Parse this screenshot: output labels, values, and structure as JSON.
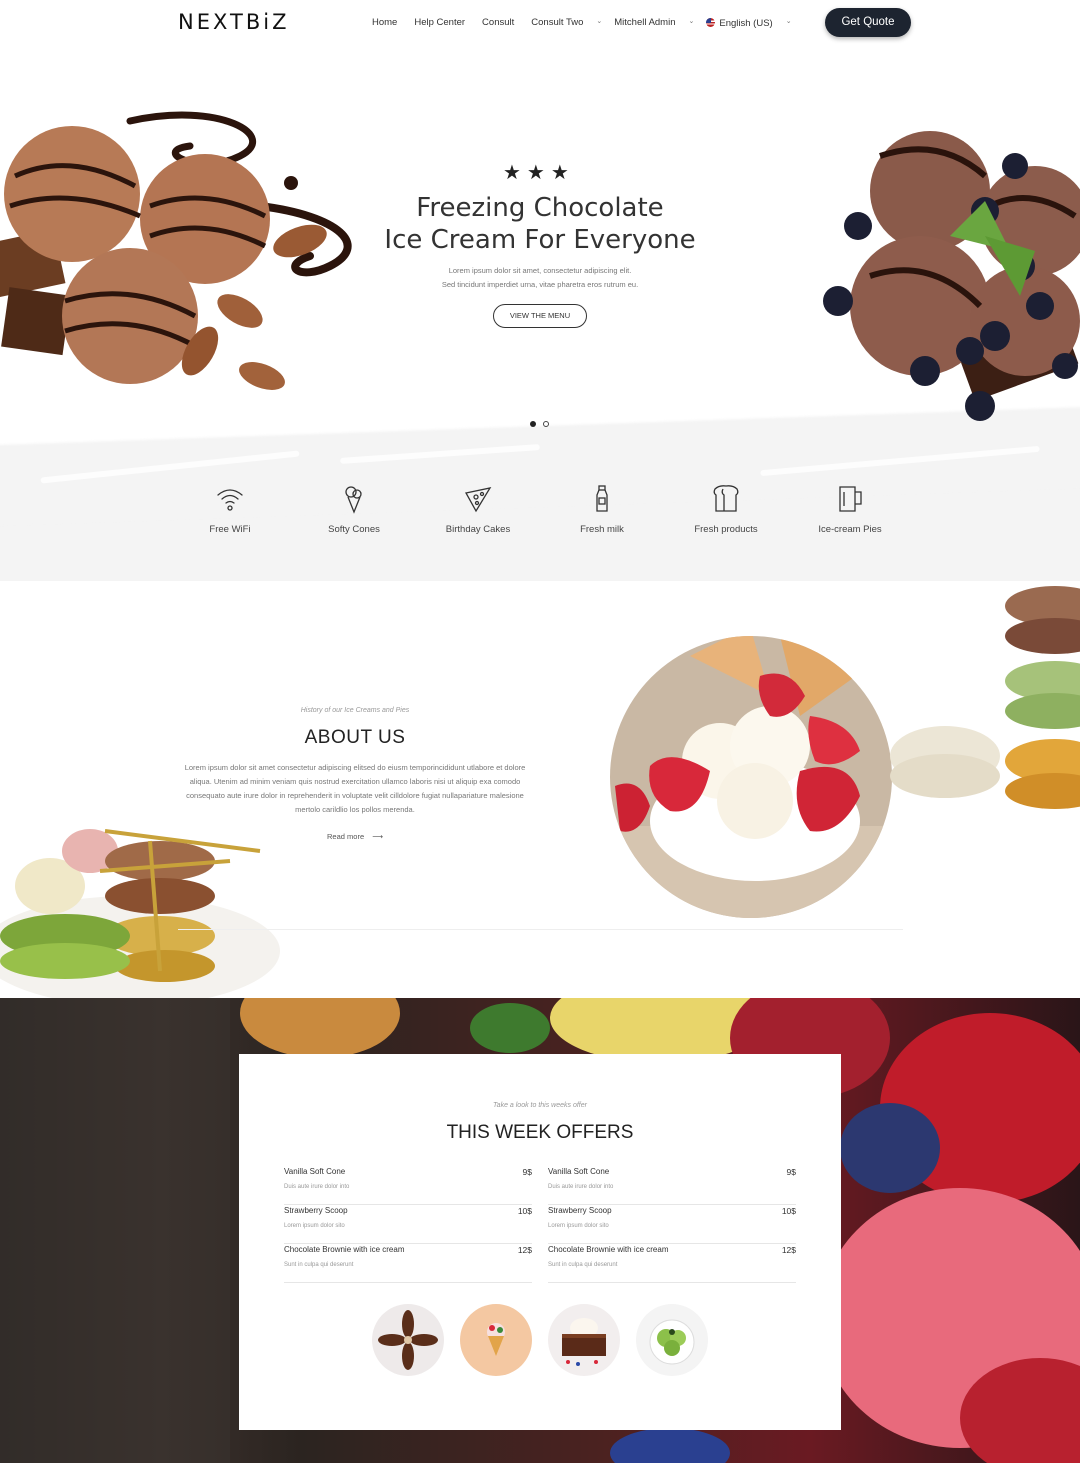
{
  "header": {
    "logo": "NEXTBiZ",
    "nav": [
      "Home",
      "Help Center",
      "Consult",
      "Consult Two"
    ],
    "user_menu": "Mitchell Admin",
    "language": "English (US)",
    "cta": "Get Quote"
  },
  "hero": {
    "stars": "★★★",
    "title_line1": "Freezing Chocolate",
    "title_line2": "Ice Cream For Everyone",
    "subtitle_line1": "Lorem ipsum dolor sit amet, consectetur adipiscing elit.",
    "subtitle_line2": "Sed tincidunt imperdiet urna, vitae pharetra eros rutrum eu.",
    "button": "VIEW THE MENU",
    "slides_total": 2,
    "active_slide": 1
  },
  "features": [
    {
      "label": "Free WiFi",
      "icon": "wifi-icon"
    },
    {
      "label": "Softy Cones",
      "icon": "ice-cream-cone-icon"
    },
    {
      "label": "Birthday Cakes",
      "icon": "pizza-slice-icon"
    },
    {
      "label": "Fresh milk",
      "icon": "milk-bottle-icon"
    },
    {
      "label": "Fresh products",
      "icon": "bread-icon"
    },
    {
      "label": "Ice-cream Pies",
      "icon": "mug-icon"
    }
  ],
  "about": {
    "kicker": "History of our Ice Creams and Pies",
    "title": "ABOUT US",
    "text": "Lorem ipsum dolor sit amet consectetur adipiscing elitsed do eiusm temporincididunt utlabore et dolore aliqua. Utenim ad minim veniam quis nostrud exercitation ullamco laboris nisi ut aliquip exa comodo consequato aute irure dolor in reprehenderit in voluptate velit cilldolore fugiat nullapariature malesione mertolo carildlio los pollos merenda.",
    "read_more": "Read more",
    "arrow": "⟶"
  },
  "offers": {
    "kicker": "Take a look to this weeks offer",
    "title": "THIS WEEK OFFERS",
    "left": [
      {
        "name": "Vanilla Soft Cone",
        "price": "9$",
        "desc": "Duis aute irure dolor into"
      },
      {
        "name": "Strawberry Scoop",
        "price": "10$",
        "desc": "Lorem ipsum dolor sito"
      },
      {
        "name": "Chocolate Brownie with ice cream",
        "price": "12$",
        "desc": "Sunt in culpa qui deserunt"
      }
    ],
    "right": [
      {
        "name": "Vanilla Soft Cone",
        "price": "9$",
        "desc": "Duis aute irure dolor into"
      },
      {
        "name": "Strawberry Scoop",
        "price": "10$",
        "desc": "Lorem ipsum dolor sito"
      },
      {
        "name": "Chocolate Brownie with ice cream",
        "price": "12$",
        "desc": "Sunt in culpa qui deserunt"
      }
    ]
  },
  "colors": {
    "primary_dark": "#1d2430",
    "text": "#333333",
    "muted": "#999999",
    "chocolate": "#b77a56",
    "strawberry": "#d8283a"
  }
}
